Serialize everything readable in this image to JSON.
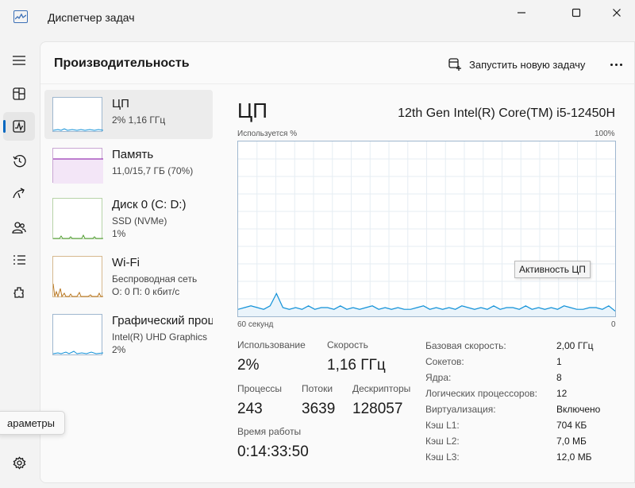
{
  "window": {
    "title": "Диспетчер задач"
  },
  "nav": {
    "items": [
      "menu-icon",
      "processes-icon",
      "performance-icon",
      "app-history-icon",
      "startup-icon",
      "users-icon",
      "details-icon",
      "services-icon"
    ],
    "tooltip": "араметры"
  },
  "header": {
    "title": "Производительность",
    "run_task": "Запустить новую задачу"
  },
  "perf_list": [
    {
      "name": "ЦП",
      "sub1": "2%  1,16 ГГц",
      "sub2": "",
      "sub3": ""
    },
    {
      "name": "Память",
      "sub1": "11,0/15,7 ГБ (70%)",
      "sub2": "",
      "sub3": ""
    },
    {
      "name": "Диск 0 (C: D:)",
      "sub1": "SSD (NVMe)",
      "sub2": "1%",
      "sub3": ""
    },
    {
      "name": "Wi-Fi",
      "sub1": "Беспроводная сеть",
      "sub2": "О: 0 П: 0 кбит/с",
      "sub3": ""
    },
    {
      "name": "Графический проц",
      "sub1": "Intel(R) UHD Graphics",
      "sub2": "2%",
      "sub3": ""
    }
  ],
  "cpu": {
    "title": "ЦП",
    "model": "12th Gen Intel(R) Core(TM) i5-12450H",
    "graph_top_left": "Используется %",
    "graph_top_right": "100%",
    "graph_bottom_left": "60 секунд",
    "graph_bottom_right": "0",
    "graph_tooltip": "Активность ЦП",
    "utilization_series": [
      4,
      5,
      6,
      5,
      4,
      6,
      13,
      5,
      4,
      5,
      4,
      6,
      4,
      5,
      5,
      4,
      6,
      4,
      5,
      4,
      5,
      6,
      4,
      5,
      4,
      5,
      4,
      4,
      5,
      6,
      4,
      5,
      4,
      5,
      4,
      6,
      5,
      4,
      5,
      4,
      6,
      4,
      5,
      5,
      4,
      6,
      4,
      5,
      4,
      5,
      4,
      6,
      5,
      4,
      4,
      5,
      5,
      4,
      6,
      3
    ],
    "stats": {
      "usage_label": "Использование",
      "usage_value": "2%",
      "speed_label": "Скорость",
      "speed_value": "1,16 ГГц",
      "processes_label": "Процессы",
      "processes_value": "243",
      "threads_label": "Потоки",
      "threads_value": "3639",
      "handles_label": "Дескрипторы",
      "handles_value": "128057",
      "uptime_label": "Время работы",
      "uptime_value": "0:14:33:50"
    },
    "specs": [
      {
        "label": "Базовая скорость:",
        "value": "2,00 ГГц"
      },
      {
        "label": "Сокетов:",
        "value": "1"
      },
      {
        "label": "Ядра:",
        "value": "8"
      },
      {
        "label": "Логических процессоров:",
        "value": "12"
      },
      {
        "label": "Виртуализация:",
        "value": "Включено"
      },
      {
        "label": "Кэш L1:",
        "value": "704 КБ"
      },
      {
        "label": "Кэш L2:",
        "value": "7,0 МБ"
      },
      {
        "label": "Кэш L3:",
        "value": "12,0 МБ"
      }
    ]
  },
  "colors": {
    "accent": "#0067c0",
    "cpu_line": "#1191d8",
    "memory_line": "#9b3ab4",
    "disk_line": "#4f9c2f",
    "wifi_line": "#b7751e"
  }
}
